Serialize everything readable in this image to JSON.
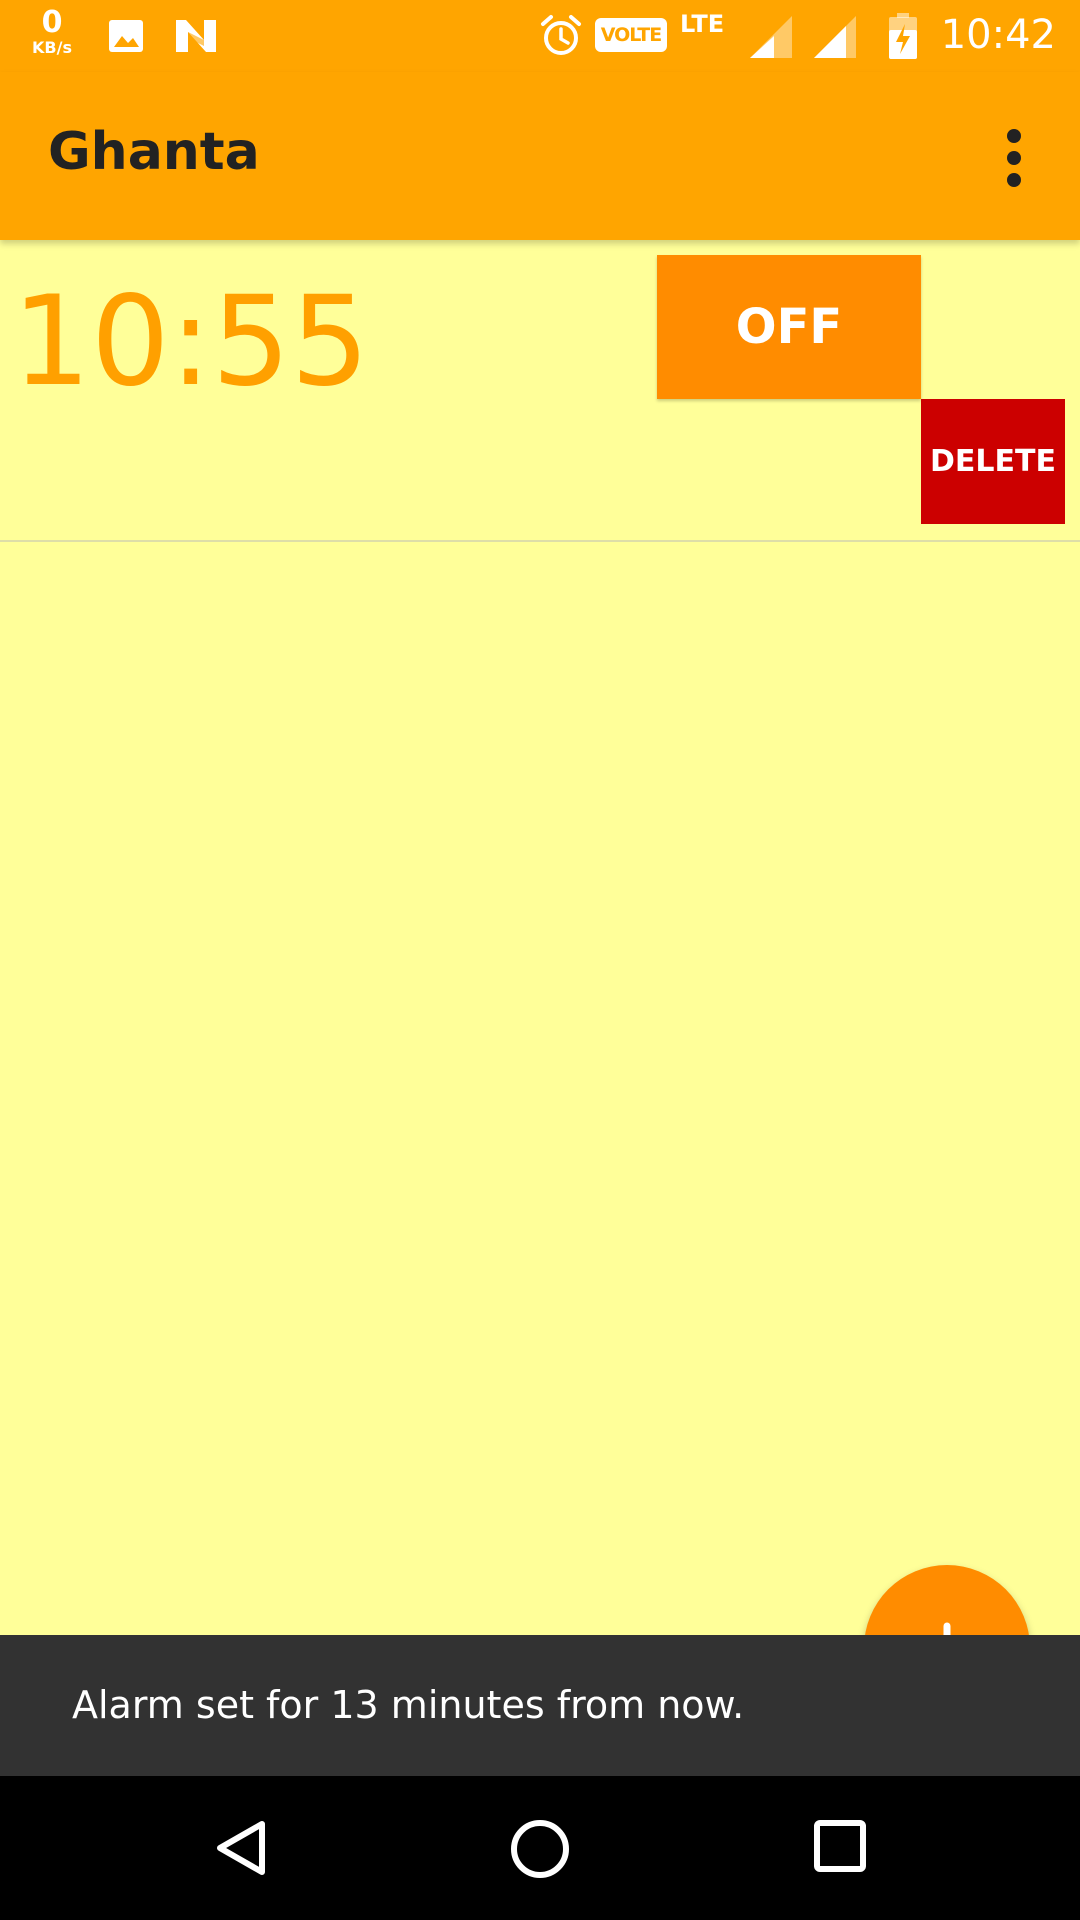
{
  "status_bar": {
    "net_speed_value": "0",
    "net_speed_unit": "KB/s",
    "icons": [
      "image-icon",
      "n-notification-icon",
      "alarm-clock-icon",
      "signal-icon",
      "battery-charging-icon"
    ],
    "volte": "VOLTE",
    "lte": "LTE",
    "time": "10:42"
  },
  "app_bar": {
    "title": "Ghanta",
    "menu_icon": "more-vert-icon",
    "background": "#FFA500"
  },
  "alarms": [
    {
      "time": "10:55",
      "toggle_label": "OFF",
      "delete_label": "DELETE"
    }
  ],
  "fab": {
    "icon": "add-icon",
    "color": "#FF8C00"
  },
  "snackbar": {
    "message": "Alarm set for 13 minutes from now."
  },
  "nav_bar": {
    "buttons": [
      "back-icon",
      "home-icon",
      "recents-icon"
    ]
  },
  "colors": {
    "background": "#FFFF99",
    "accent": "#FFA500",
    "button": "#FF8C00",
    "delete": "#CC0000",
    "time_text": "#FFA000"
  }
}
